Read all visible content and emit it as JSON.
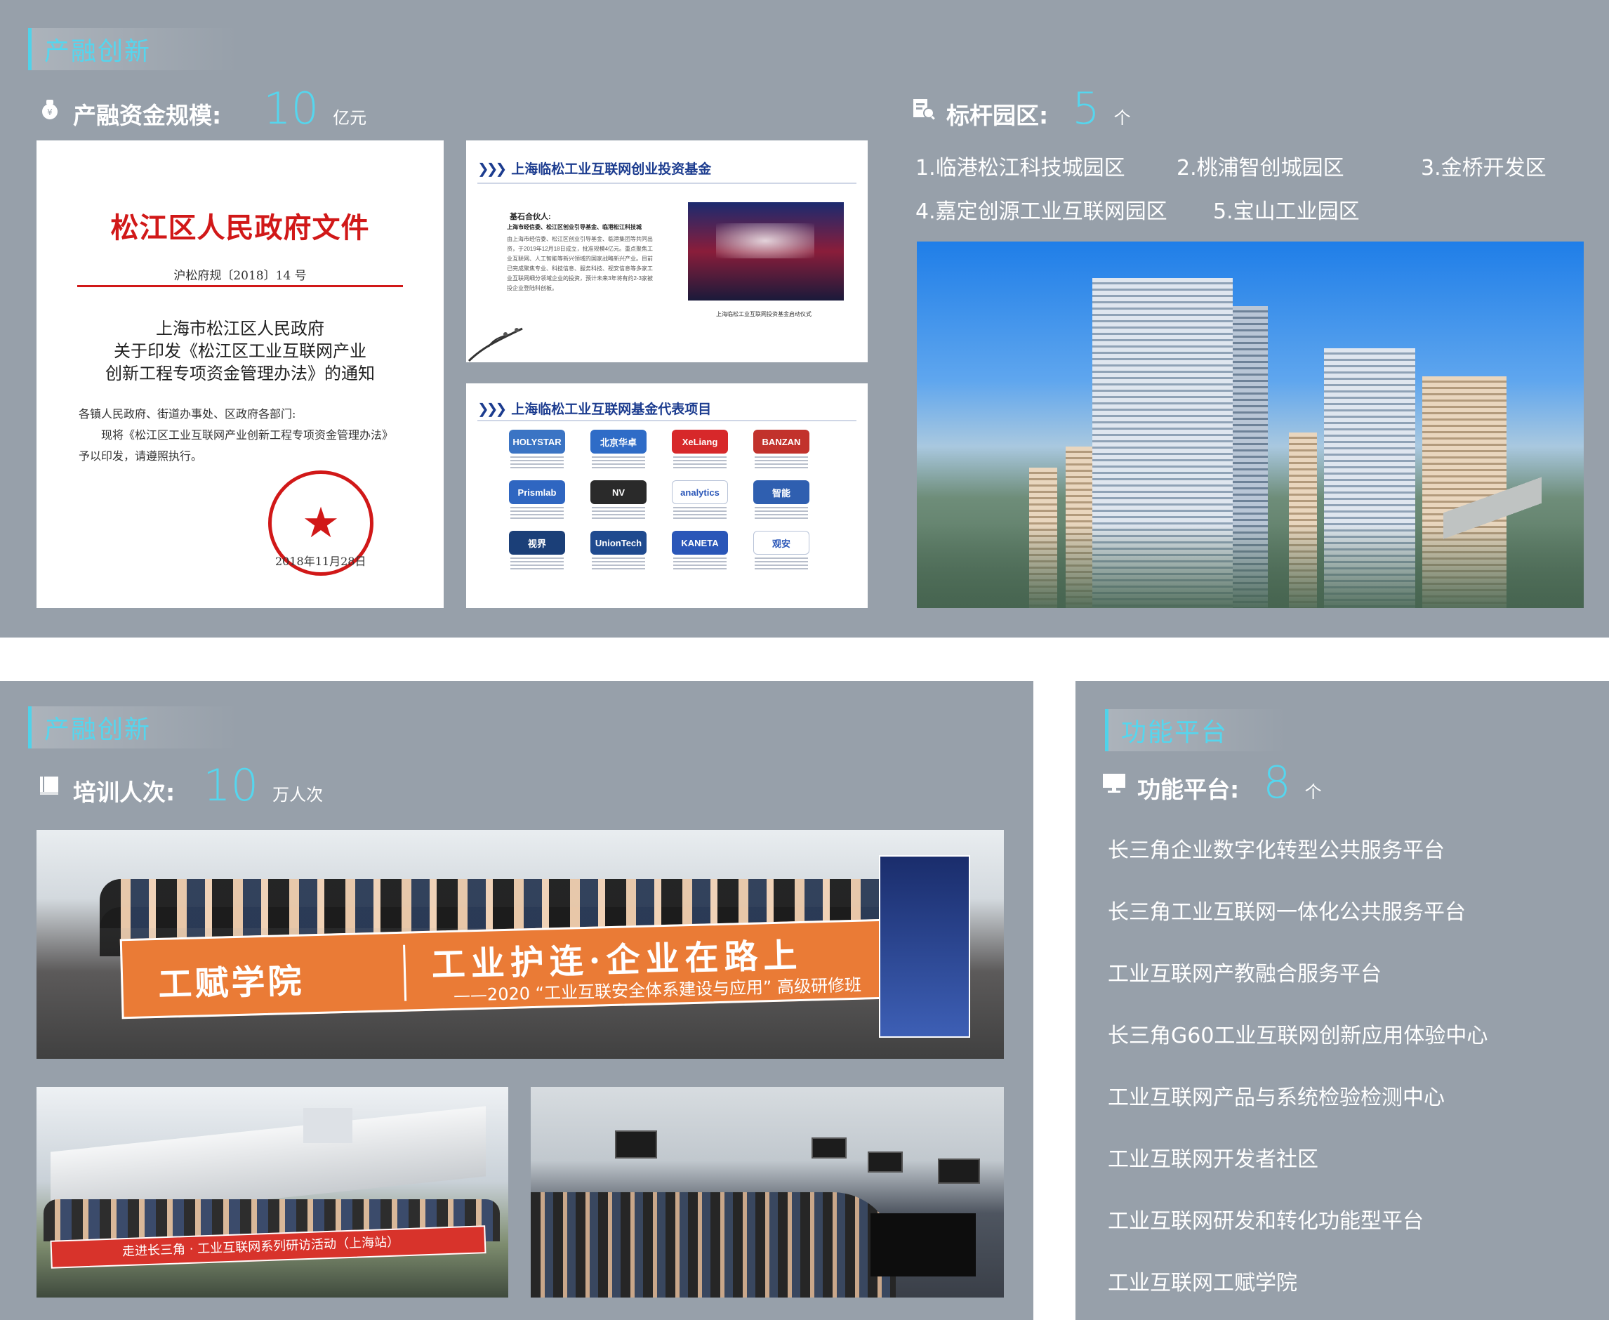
{
  "top": {
    "section_tab": "产融创新",
    "fund_stat": {
      "label": "产融资金规模:",
      "value": "10",
      "unit": "亿元"
    },
    "park_stat": {
      "label": "标杆园区:",
      "value": "5",
      "unit": "个"
    },
    "parks": [
      "1.临港松江科技城园区",
      "2.桃浦智创城园区",
      "3.金桥开发区",
      "4.嘉定创源工业互联网园区",
      "5.宝山工业园区"
    ],
    "doc": {
      "title": "松江区人民政府文件",
      "number": "沪松府规〔2018〕14 号",
      "heading_lines": [
        "上海市松江区人民政府",
        "关于印发《松江区工业互联网产业",
        "创新工程专项资金管理办法》的通知"
      ],
      "body_lines": [
        "各镇人民政府、街道办事处、区政府各部门:",
        "现将《松江区工业互联网产业创新工程专项资金管理办法》",
        "予以印发，请遵照执行。"
      ],
      "date": "2018年11月28日"
    },
    "slide_fund": {
      "heading": "上海临松工业互联网创业投资基金",
      "sub": "基石合伙人:",
      "sub2": "上海市经信委、松江区创业引导基金、临港松江科技城",
      "text": "由上海市经信委、松江区创业引导基金、临港集团等共同出资，于2019年12月18日成立，批准规模4亿元。重点聚焦工业互联网、人工智能等新兴领域的国家战略新兴产业。目前已完成聚焦专业、科技信息、服务科技、视安信息等多家工业互联网细分领域企业的投资，预计未来3年将有约2-3家被投企业登陆科创板。",
      "photo_caption": "上海临松工业互联网投资基金启动仪式"
    },
    "slide_proj": {
      "heading": "上海临松工业互联网基金代表项目",
      "logos": [
        {
          "name": "HOLYSTAR",
          "color": "#3b74c4"
        },
        {
          "name": "北京华卓",
          "color": "#2f6cc7"
        },
        {
          "name": "XeLiang",
          "color": "#d7282a"
        },
        {
          "name": "BANZAN",
          "color": "#c2322c"
        },
        {
          "name": "Prismlab",
          "color": "#2f66c1"
        },
        {
          "name": "NV",
          "color": "#2a2a2a"
        },
        {
          "name": "analytics",
          "color": "#ffffff"
        },
        {
          "name": "智能",
          "color": "#2f5fb0"
        },
        {
          "name": "视界",
          "color": "#1b3f78"
        },
        {
          "name": "UnionTech",
          "color": "#1f4a8f"
        },
        {
          "name": "KANETA",
          "color": "#2a56b8"
        },
        {
          "name": "观安",
          "color": "#ffffff"
        }
      ]
    }
  },
  "bottom_left": {
    "section_tab": "产融创新",
    "stat": {
      "label": "培训人次:",
      "value": "10",
      "unit": "万人次"
    },
    "banner": {
      "left": "工赋学院",
      "main": "工业护连·企业在路上",
      "sub": "——2020 “工业互联安全体系建设与应用” 高级研修班"
    },
    "banner2": "走进长三角 · 工业互联网系列研访活动（上海站）"
  },
  "bottom_right": {
    "section_tab": "功能平台",
    "stat": {
      "label": "功能平台:",
      "value": "8",
      "unit": "个"
    },
    "platforms": [
      "长三角企业数字化转型公共服务平台",
      "长三角工业互联网一体化公共服务平台",
      "工业互联网产教融合服务平台",
      "长三角G60工业互联网创新应用体验中心",
      "工业互联网产品与系统检验检测中心",
      "工业互联网开发者社区",
      "工业互联网研发和转化功能型平台",
      "工业互联网工赋学院"
    ]
  },
  "colors": {
    "panel": "#97a0aa",
    "accent": "#55d6ee",
    "doc_red": "#d11818",
    "banner_orange": "#ea7b36"
  },
  "icons": [
    "money-bag-icon",
    "park-document-icon",
    "book-icon",
    "monitor-icon"
  ]
}
